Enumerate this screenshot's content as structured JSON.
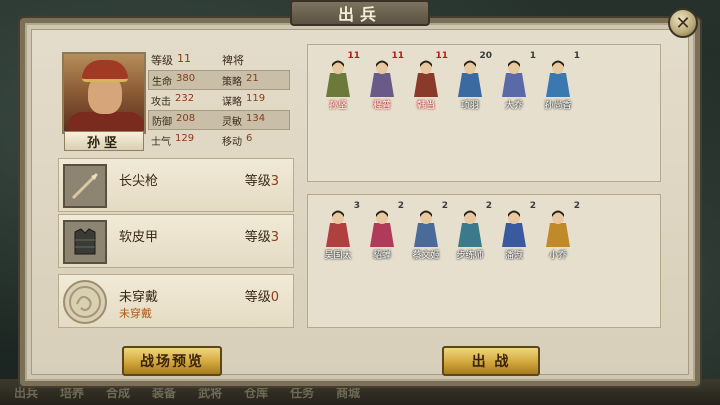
{
  "window": {
    "title": "出兵",
    "close_glyph": "✕"
  },
  "bottom_nav": [
    "出兵",
    "培养",
    "合成",
    "装备",
    "武将",
    "仓库",
    "任务",
    "商城"
  ],
  "general": {
    "name": "孙坚",
    "stats": {
      "level_label": "等级",
      "level_value": "11",
      "class_label": "禆将",
      "hp_label": "生命",
      "hp_value": "380",
      "strategy_label": "策略",
      "strategy_value": "21",
      "attack_label": "攻击",
      "attack_value": "232",
      "tactics_label": "谋略",
      "tactics_value": "119",
      "defense_label": "防御",
      "defense_value": "208",
      "agility_label": "灵敏",
      "agility_value": "134",
      "morale_label": "士气",
      "morale_value": "129",
      "move_label": "移动",
      "move_value": "6"
    }
  },
  "equipment": [
    {
      "name": "长尖枪",
      "level_label": "等级",
      "level_value": "3",
      "sub": "",
      "icon": "spear-icon"
    },
    {
      "name": "软皮甲",
      "level_label": "等级",
      "level_value": "3",
      "sub": "",
      "icon": "armor-icon"
    },
    {
      "name": "未穿戴",
      "level_label": "等级",
      "level_value": "0",
      "sub": "未穿戴",
      "icon": "dragon-emblem-icon"
    }
  ],
  "selected_heroes": [
    {
      "name": "孙坚",
      "count": "11",
      "red": true,
      "color": "#6b7a3a"
    },
    {
      "name": "程普",
      "count": "11",
      "red": true,
      "color": "#6a5a8a"
    },
    {
      "name": "韩当",
      "count": "11",
      "red": true,
      "color": "#8a3a2a"
    },
    {
      "name": "项羽",
      "count": "20",
      "red": false,
      "color": "#3a6aa0"
    },
    {
      "name": "大乔",
      "count": "1",
      "red": false,
      "color": "#5a6aa8"
    },
    {
      "name": "孙尚香",
      "count": "1",
      "red": false,
      "color": "#3a78b0"
    }
  ],
  "reserve_heroes": [
    {
      "name": "吴国太",
      "count": "3",
      "red": false,
      "color": "#b04040"
    },
    {
      "name": "貂蝉",
      "count": "2",
      "red": false,
      "color": "#b03a5a"
    },
    {
      "name": "蔡文姬",
      "count": "2",
      "red": false,
      "color": "#4a6a9a"
    },
    {
      "name": "步练师",
      "count": "2",
      "red": false,
      "color": "#3a7a8a"
    },
    {
      "name": "潘淑",
      "count": "2",
      "red": false,
      "color": "#3a5aa0"
    },
    {
      "name": "小乔",
      "count": "2",
      "red": false,
      "color": "#c08a2a"
    }
  ],
  "buttons": {
    "preview": "战场预览",
    "deploy": "出 战"
  }
}
